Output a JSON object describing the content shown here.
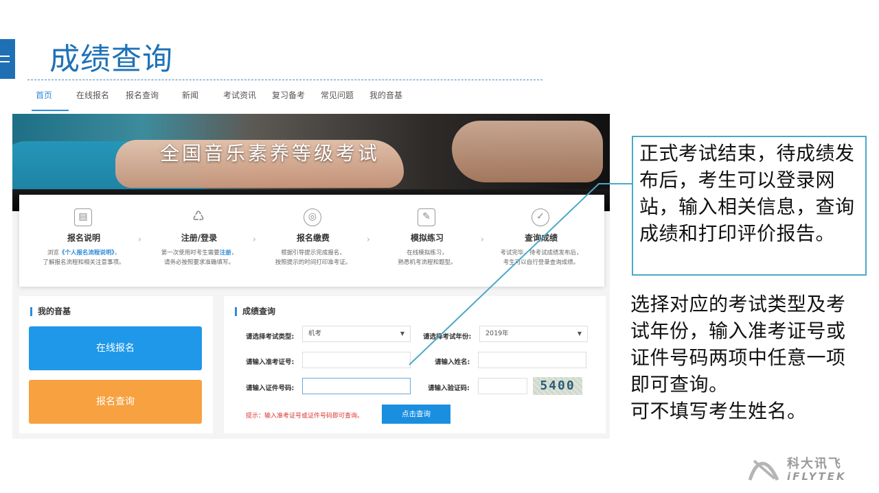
{
  "slide": {
    "title": "成绩查询",
    "callout_text": "正式考试结束，待成绩发布后，考生可以登录网站，输入相关信息，查询成绩和打印评价报告。",
    "note_lines": [
      "选择对应的考试类型及考试年份，输入准考证号或证件号码两项中任意一项即可查询。",
      "可不填写考生姓名。"
    ],
    "logo_cn": "科大讯飞",
    "logo_en": "iFLYTEK"
  },
  "nav": {
    "items": [
      "首页",
      "在线报名",
      "报名查询",
      "新闻",
      "考试资讯",
      "复习备考",
      "常见问题",
      "我的音基"
    ]
  },
  "banner": {
    "title": "全国音乐素养等级考试"
  },
  "steps": [
    {
      "title": "报名说明",
      "desc1_pre": "浏览",
      "desc1_link": "《个人报名流程说明》",
      "desc1_post": "，",
      "desc2": "了解报名流程和相关注意事项。",
      "icon": "document-icon"
    },
    {
      "title": "注册/登录",
      "desc1_pre": "第一次使用时考生需要",
      "desc1_link": "注册",
      "desc1_post": "，",
      "desc2": "请务必按照要求准确填写。",
      "icon": "recycle-icon"
    },
    {
      "title": "报名缴费",
      "desc1_pre": "根据引导提示完成报名，",
      "desc1_link": "",
      "desc1_post": "",
      "desc2": "按照提示的时间打印准考证。",
      "icon": "coins-icon"
    },
    {
      "title": "模拟练习",
      "desc1_pre": "在线模拟练习，",
      "desc1_link": "",
      "desc1_post": "",
      "desc2": "熟悉机考流程和题型。",
      "icon": "edit-icon"
    },
    {
      "title": "查询成绩",
      "desc1_pre": "考试完毕，待考试成绩发布后，",
      "desc1_link": "",
      "desc1_post": "",
      "desc2": "考生可以自行登录查询成绩。",
      "icon": "check-circle-icon"
    }
  ],
  "left_panel": {
    "title": "我的音基",
    "register_label": "在线报名",
    "query_label": "报名查询"
  },
  "query_panel": {
    "title": "成绩查询",
    "exam_type_label": "请选择考试类型:",
    "exam_type_value": "机考",
    "exam_year_label": "请选择考试年份:",
    "exam_year_value": "2019年",
    "ticket_label": "请输入准考证号:",
    "name_label": "请输入姓名:",
    "id_label": "请输入证件号码:",
    "captcha_label": "请输入验证码:",
    "captcha_value": "5400",
    "tip": "提示：输入准考证号或证件号码即可查询。",
    "submit_label": "点击查询"
  },
  "colors": {
    "brand_blue": "#1e72b8",
    "button_blue": "#1a8fe0",
    "button_orange": "#f7a140",
    "callout_border": "#4aa8c8"
  }
}
